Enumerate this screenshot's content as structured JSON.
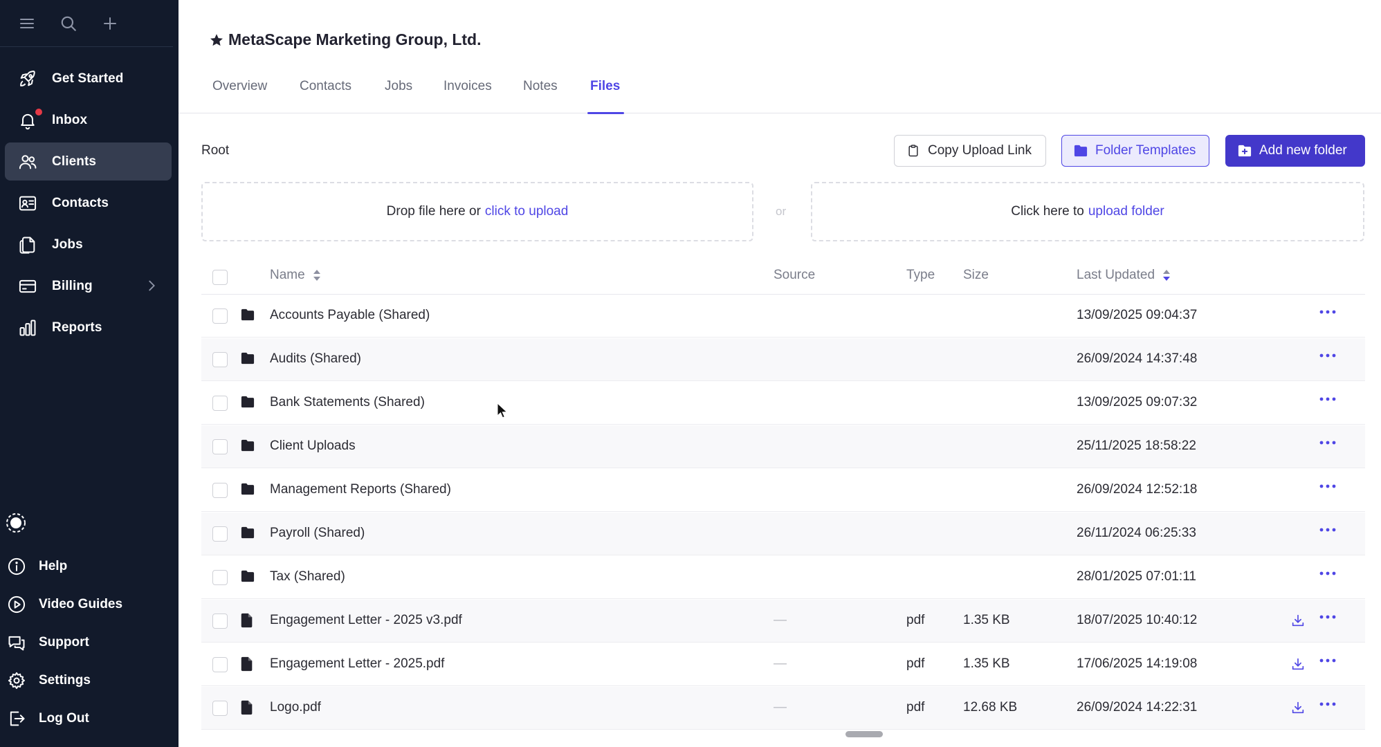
{
  "sidebar": {
    "top_icons": [
      "menu-icon",
      "search-icon",
      "plus-icon"
    ],
    "items": [
      {
        "label": "Get Started",
        "icon": "rocket-icon"
      },
      {
        "label": "Inbox",
        "icon": "bell-icon",
        "badge": "unread-dot"
      },
      {
        "label": "Clients",
        "icon": "users-icon",
        "active": true
      },
      {
        "label": "Contacts",
        "icon": "contact-card-icon"
      },
      {
        "label": "Jobs",
        "icon": "documents-icon"
      },
      {
        "label": "Billing",
        "icon": "credit-card-icon",
        "has_submenu": true
      },
      {
        "label": "Reports",
        "icon": "bar-chart-icon"
      }
    ],
    "bottom_items": [
      {
        "label": "Help",
        "icon": "info-icon"
      },
      {
        "label": "Video Guides",
        "icon": "play-circle-icon"
      },
      {
        "label": "Support",
        "icon": "chat-icon"
      },
      {
        "label": "Settings",
        "icon": "gear-icon"
      },
      {
        "label": "Log Out",
        "icon": "logout-icon"
      }
    ]
  },
  "header": {
    "title": "MetaScape Marketing Group, Ltd.",
    "starred": true
  },
  "tabs": [
    {
      "label": "Overview"
    },
    {
      "label": "Contacts"
    },
    {
      "label": "Jobs"
    },
    {
      "label": "Invoices"
    },
    {
      "label": "Notes"
    },
    {
      "label": "Files",
      "active": true
    }
  ],
  "files": {
    "breadcrumb": "Root",
    "buttons": {
      "copy_link": "Copy Upload Link",
      "templates": "Folder Templates",
      "add_folder": "Add new folder"
    },
    "dropzone_file": {
      "text": "Drop file here or",
      "link": "click to upload"
    },
    "separator": "or",
    "dropzone_folder": {
      "text": "Click here to",
      "link": "upload folder"
    },
    "columns": {
      "name": "Name",
      "source": "Source",
      "type": "Type",
      "size": "Size",
      "updated": "Last Updated"
    },
    "rows": [
      {
        "kind": "folder",
        "name": "Accounts Payable (Shared)",
        "source": "",
        "type": "",
        "size": "",
        "updated": "13/09/2025 09:04:37"
      },
      {
        "kind": "folder",
        "name": "Audits (Shared)",
        "source": "",
        "type": "",
        "size": "",
        "updated": "26/09/2024 14:37:48"
      },
      {
        "kind": "folder",
        "name": "Bank Statements (Shared)",
        "source": "",
        "type": "",
        "size": "",
        "updated": "13/09/2025 09:07:32"
      },
      {
        "kind": "folder",
        "name": "Client Uploads",
        "source": "",
        "type": "",
        "size": "",
        "updated": "25/11/2025 18:58:22"
      },
      {
        "kind": "folder",
        "name": "Management Reports (Shared)",
        "source": "",
        "type": "",
        "size": "",
        "updated": "26/09/2024 12:52:18"
      },
      {
        "kind": "folder",
        "name": "Payroll (Shared)",
        "source": "",
        "type": "",
        "size": "",
        "updated": "26/11/2024 06:25:33"
      },
      {
        "kind": "folder",
        "name": "Tax (Shared)",
        "source": "",
        "type": "",
        "size": "",
        "updated": "28/01/2025 07:01:11"
      },
      {
        "kind": "file",
        "name": "Engagement Letter - 2025 v3.pdf",
        "source": "—",
        "type": "pdf",
        "size": "1.35 KB",
        "updated": "18/07/2025 10:40:12"
      },
      {
        "kind": "file",
        "name": "Engagement Letter - 2025.pdf",
        "source": "—",
        "type": "pdf",
        "size": "1.35 KB",
        "updated": "17/06/2025 14:19:08"
      },
      {
        "kind": "file",
        "name": "Logo.pdf",
        "source": "—",
        "type": "pdf",
        "size": "12.68 KB",
        "updated": "26/09/2024 14:22:31"
      }
    ]
  },
  "colors": {
    "sidebar_bg": "#121a2b",
    "accent": "#4f46e5",
    "primary_button": "#4338ca",
    "badge_red": "#e53946"
  }
}
